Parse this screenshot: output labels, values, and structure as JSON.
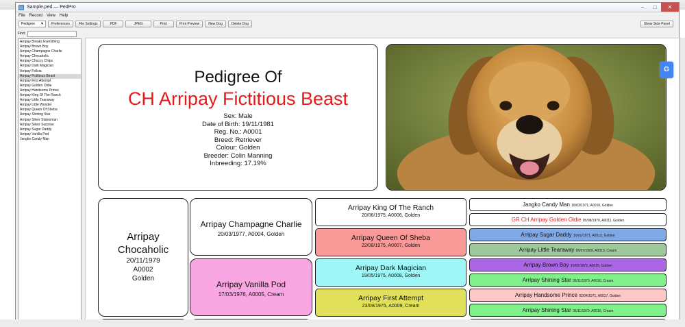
{
  "window": {
    "title": "Sample.ped — PedPro"
  },
  "menu": [
    "File",
    "Record",
    "View",
    "Help"
  ],
  "toolbar": {
    "view_select": "Pedigree",
    "buttons": [
      "Preferences",
      "File Settings",
      "PDF",
      "JPEG",
      "Print",
      "Print Preview",
      "New Dog",
      "Delete Dog"
    ],
    "side_panel": "Show Side Panel"
  },
  "sidebar": {
    "find_label": "Find:",
    "find_value": "",
    "items": [
      "Arripay Breaks Everything",
      "Arripay Brown Boy",
      "Arripay Champagne Charlie",
      "Arripay Chocaholic",
      "Arripay Choccy Chips",
      "Arripay Dark Magician",
      "Arripay Felicia",
      "Arripay Fictitious Beast",
      "Arripay First Attempt",
      "Arripay Golden Oldie",
      "Arripay Handsome Prince",
      "Arripay King Of The Ranch",
      "Arripay Little Tearaway",
      "Arripay Little Wonder",
      "Arripay Queen Of Sheba",
      "Arripay Shining Star",
      "Arripay Silver Statesman",
      "Arripay Silver Surprise",
      "Arripay Sugar Daddy",
      "Arripay Vanilla Pod",
      "Jangko Candy Man"
    ],
    "selected": "Arripay Fictitious Beast"
  },
  "subject": {
    "heading": "Pedigree Of",
    "name": "CH Arripay Fictitious Beast",
    "sex": "Sex: Male",
    "dob": "Date of Birth: 19/11/1981",
    "reg": "Reg. No.: A0001",
    "breed": "Breed: Retriever",
    "colour": "Colour: Golden",
    "breeder": "Breeder: Colin Manning",
    "inbreeding": "Inbreeding: 17.19%"
  },
  "colors": {
    "accent_red": "#e8191a",
    "g2_dam": "#f9a7e2",
    "g3_b": "#f99a99",
    "g3_c": "#9ef6f6",
    "g3_d": "#e0e05a"
  },
  "gen1": {
    "name_line1": "Arripay",
    "name_line2": "Chocaholic",
    "dob": "20/11/1979",
    "reg": "A0002",
    "colour": "Golden"
  },
  "gen2": [
    {
      "name": "Arripay Champagne Charlie",
      "details": "20/03/1977, A0004, Golden"
    },
    {
      "name": "Arripay Vanilla Pod",
      "details": "17/03/1976, A0005, Cream"
    }
  ],
  "gen3": [
    {
      "name": "Arripay King Of The Ranch",
      "details": "20/06/1975, A0006, Golden"
    },
    {
      "name": "Arripay Queen Of Sheba",
      "details": "22/08/1975, A0007, Golden"
    },
    {
      "name": "Arripay Dark Magician",
      "details": "19/05/1975, A0008, Golden"
    },
    {
      "name": "Arripay First Attempt",
      "details": "23/09/1975, A0009, Cream"
    }
  ],
  "gen4": [
    {
      "name": "Jangko Candy Man",
      "details": "18/03/1971, A0010, Golden"
    },
    {
      "name": "GR CH Arripay Golden Oldie",
      "details": "05/08/1970, A0011, Golden"
    },
    {
      "name": "Arripay Sugar Daddy",
      "details": "10/01/1971, A0012, Golden"
    },
    {
      "name": "Arripay Little Tearaway",
      "details": "05/07/1969, A0013, Cream"
    },
    {
      "name": "Arripay Brown Boy",
      "details": "10/02/1972, A0015, Golden"
    },
    {
      "name": "Arripay Shining Star",
      "details": "05/11/1970, A0016, Cream"
    },
    {
      "name": "Arripay Handsome Prince",
      "details": "02/04/1971, A0017, Golden"
    },
    {
      "name": "Arripay Shining Star",
      "details": "05/11/1970, A0016, Cream"
    }
  ]
}
